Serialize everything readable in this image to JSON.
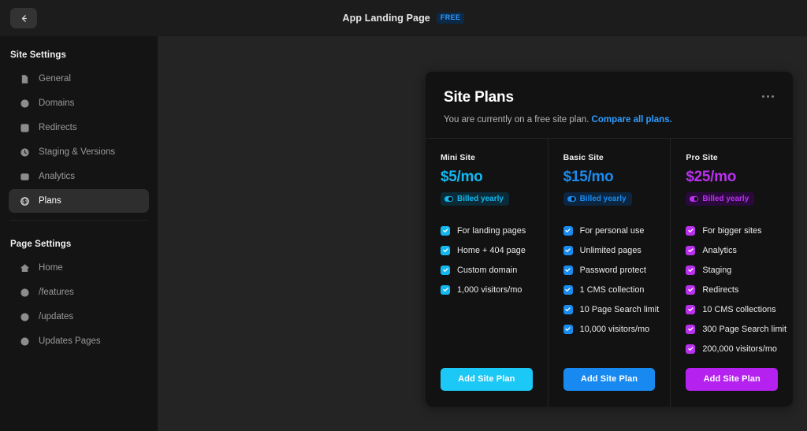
{
  "topbar": {
    "back_icon": "arrow-left-icon",
    "title": "App Landing Page",
    "badge": "FREE"
  },
  "sidebar": {
    "site_settings_title": "Site Settings",
    "site_items": [
      {
        "label": "General",
        "icon": "file-icon",
        "active": false
      },
      {
        "label": "Domains",
        "icon": "globe-icon",
        "active": false
      },
      {
        "label": "Redirects",
        "icon": "redirect-arrow-icon",
        "active": false
      },
      {
        "label": "Staging & Versions",
        "icon": "clock-icon",
        "active": false
      },
      {
        "label": "Analytics",
        "icon": "analytics-icon",
        "active": false
      },
      {
        "label": "Plans",
        "icon": "dollar-circle-icon",
        "active": true
      }
    ],
    "page_settings_title": "Page Settings",
    "page_items": [
      {
        "label": "Home",
        "icon": "home-icon"
      },
      {
        "label": "/features",
        "icon": "globe-icon"
      },
      {
        "label": "/updates",
        "icon": "globe-icon"
      },
      {
        "label": "Updates Pages",
        "icon": "globe-icon"
      }
    ]
  },
  "card": {
    "title": "Site Plans",
    "subtitle_text": "You are currently on a free site plan.",
    "subtitle_link": "Compare all plans.",
    "more_icon": "ellipsis-icon"
  },
  "plans": [
    {
      "name": "Mini Site",
      "price": "$5/mo",
      "billed_label": "Billed yearly",
      "accent": "#13b8f0",
      "badge_bg": "#0b2b38",
      "button_bg": "#1cc8f5",
      "features": [
        "For landing pages",
        "Home + 404 page",
        "Custom domain",
        "1,000 visitors/mo"
      ],
      "cta": "Add Site Plan"
    },
    {
      "name": "Basic Site",
      "price": "$15/mo",
      "billed_label": "Billed yearly",
      "accent": "#1a8cf0",
      "badge_bg": "#0c2540",
      "button_bg": "#1789f0",
      "features": [
        "For personal use",
        "Unlimited pages",
        "Password protect",
        "1 CMS collection",
        "10 Page Search limit",
        "10,000 visitors/mo"
      ],
      "cta": "Add Site Plan"
    },
    {
      "name": "Pro Site",
      "price": "$25/mo",
      "billed_label": "Billed yearly",
      "accent": "#bb30f0",
      "badge_bg": "#2a0a3d",
      "button_bg": "#b521ef",
      "features": [
        "For bigger sites",
        "Analytics",
        "Staging",
        "Redirects",
        "10 CMS collections",
        "300 Page Search limit",
        "200,000 visitors/mo"
      ],
      "cta": "Add Site Plan"
    }
  ]
}
